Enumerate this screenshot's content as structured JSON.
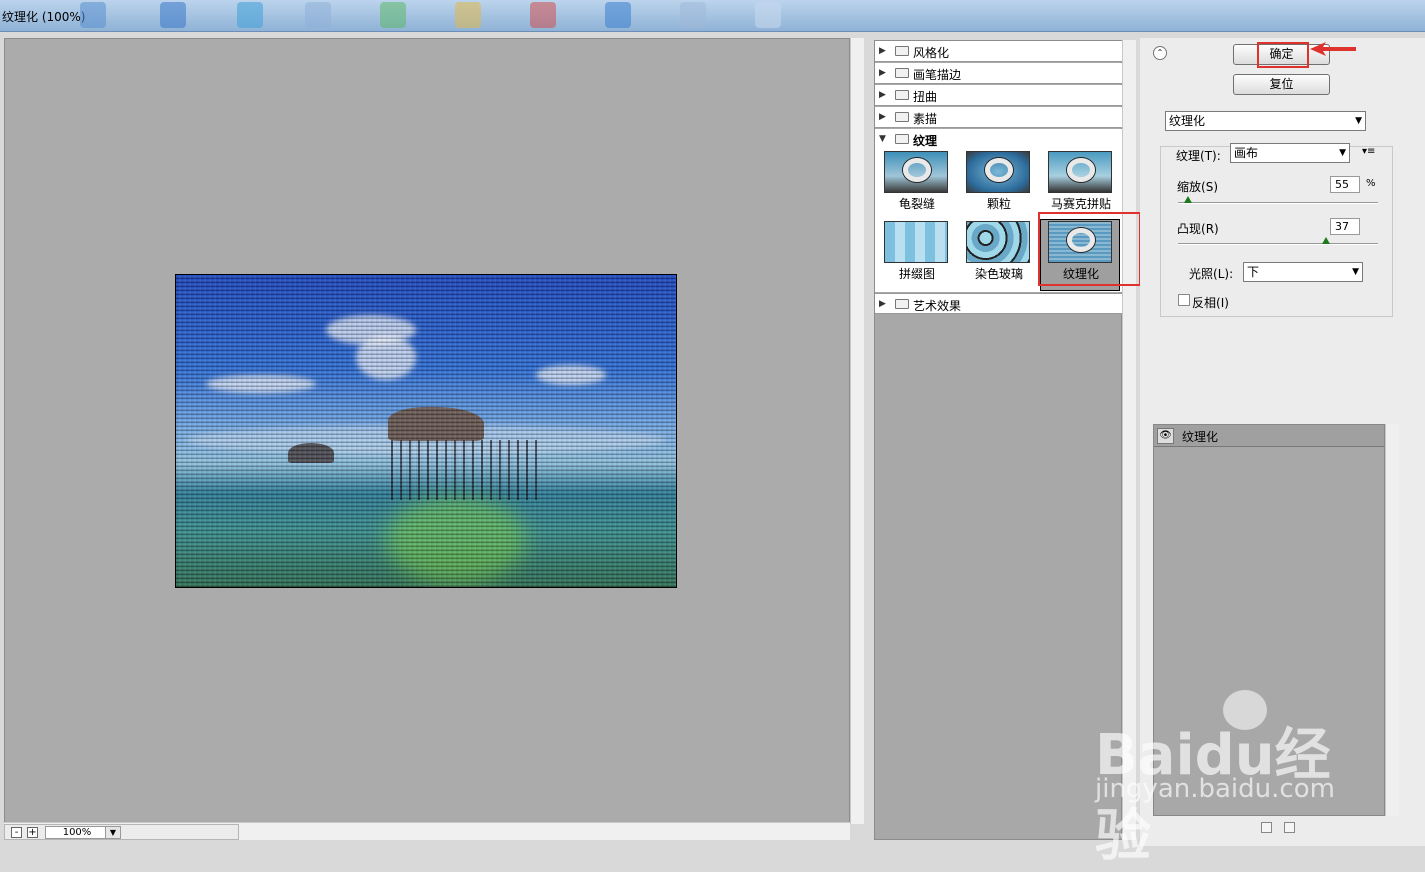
{
  "window": {
    "title": "纹理化 (100%)"
  },
  "preview": {
    "zoom_value": "100%",
    "zoom_out": "-",
    "zoom_in": "+"
  },
  "filter_categories": [
    {
      "label": "风格化",
      "expanded": false
    },
    {
      "label": "画笔描边",
      "expanded": false
    },
    {
      "label": "扭曲",
      "expanded": false
    },
    {
      "label": "素描",
      "expanded": false
    },
    {
      "label": "纹理",
      "expanded": true
    },
    {
      "label": "艺术效果",
      "expanded": false
    }
  ],
  "texture_filters": [
    {
      "label": "龟裂缝",
      "selected": false
    },
    {
      "label": "颗粒",
      "selected": false
    },
    {
      "label": "马赛克拼贴",
      "selected": false
    },
    {
      "label": "拼缀图",
      "selected": false
    },
    {
      "label": "染色玻璃",
      "selected": false
    },
    {
      "label": "纹理化",
      "selected": true
    }
  ],
  "buttons": {
    "ok_label": "确定",
    "reset_label": "复位"
  },
  "filter_select": {
    "value": "纹理化"
  },
  "settings": {
    "texture_label": "纹理",
    "texture_shortcut": "(T)",
    "texture_value": "画布",
    "scaling_label": "缩放",
    "scaling_shortcut": "(S)",
    "scaling_value": "55",
    "scaling_unit": "%",
    "scaling_fraction": 0.05,
    "relief_label": "凸现",
    "relief_shortcut": "(R)",
    "relief_value": "37",
    "relief_fraction": 0.74,
    "light_label": "光照",
    "light_shortcut": "(L)",
    "light_value": "下",
    "invert_label": "反相",
    "invert_shortcut": "(I)",
    "invert_checked": false
  },
  "layers": [
    {
      "label": "纹理化",
      "visible": true
    }
  ],
  "watermark": {
    "brand": "Baidu经验",
    "url": "jingyan.baidu.com"
  },
  "colors": {
    "highlight_red": "#e0322d",
    "panel_gray": "#a8a8a8"
  }
}
